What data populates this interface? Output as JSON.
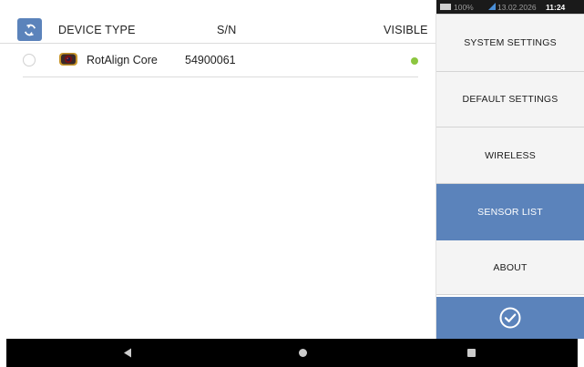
{
  "sensor_list": {
    "headers": {
      "device_type": "DEVICE TYPE",
      "serial": "S/N",
      "visible": "VISIBLE"
    },
    "rows": [
      {
        "device_name": "RotAlign Core",
        "serial": "54900061",
        "visible": true,
        "visible_color": "#8cc63f",
        "selected": false,
        "icon": "sensor-device-icon"
      }
    ],
    "refresh_icon": "refresh-icon"
  },
  "status_bar": {
    "battery": "100%",
    "date": "13.02.2026",
    "time": "11:24"
  },
  "menu": {
    "items": [
      {
        "label": "SYSTEM SETTINGS",
        "active": false
      },
      {
        "label": "DEFAULT SETTINGS",
        "active": false
      },
      {
        "label": "WIRELESS",
        "active": false
      },
      {
        "label": "SENSOR LIST",
        "active": true
      },
      {
        "label": "ABOUT",
        "active": false
      }
    ],
    "confirm_icon": "checkmark-circle-icon"
  },
  "colors": {
    "accent": "#5b83bb",
    "visible_dot": "#8cc63f",
    "menu_bg": "#f4f4f4"
  },
  "navbar": {
    "icons": [
      "back-icon",
      "home-icon",
      "recents-icon"
    ]
  }
}
